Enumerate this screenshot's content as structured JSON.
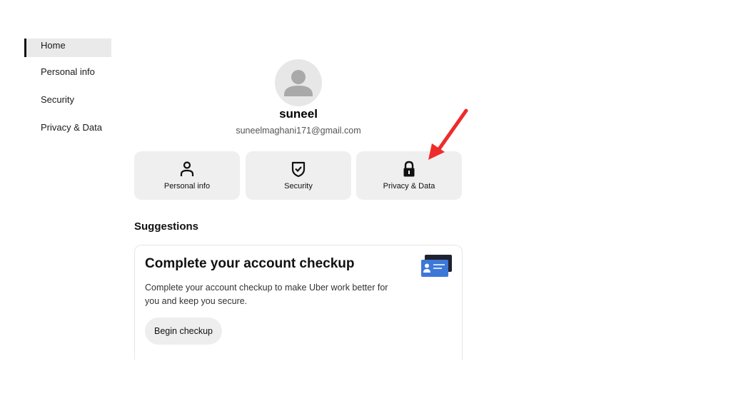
{
  "sidebar": {
    "items": [
      {
        "label": "Home"
      },
      {
        "label": "Personal info"
      },
      {
        "label": "Security"
      },
      {
        "label": "Privacy & Data"
      }
    ]
  },
  "profile": {
    "name": "suneel",
    "email": "suneelmaghani171@gmail.com"
  },
  "quick_access": [
    {
      "label": "Personal info",
      "icon": "person-icon"
    },
    {
      "label": "Security",
      "icon": "shield-check-icon"
    },
    {
      "label": "Privacy & Data",
      "icon": "lock-icon"
    }
  ],
  "suggestions": {
    "title": "Suggestions",
    "card": {
      "heading": "Complete your account checkup",
      "body": "Complete your account checkup to make Uber work better for you and keep you secure.",
      "button": "Begin checkup",
      "illustration": "id-card-icon"
    }
  },
  "annotation": {
    "arrow_color": "#ee2b2b",
    "points_to": "Privacy & Data"
  }
}
